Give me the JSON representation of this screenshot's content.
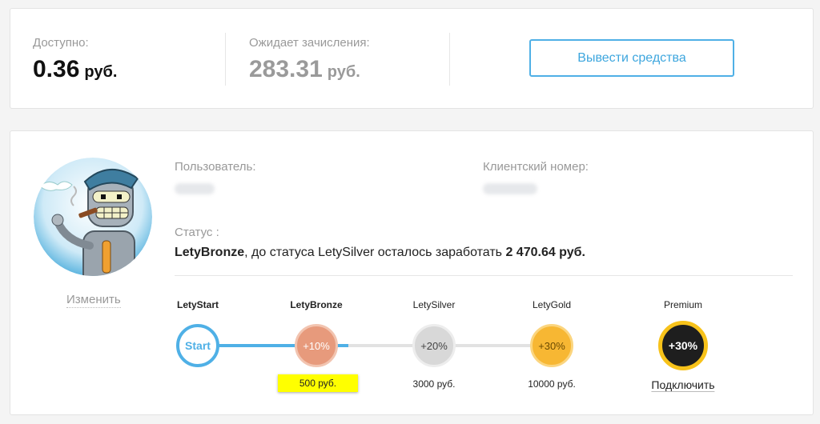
{
  "balance": {
    "available_label": "Доступно:",
    "available_value": "0.36",
    "currency": "руб.",
    "pending_label": "Ожидает зачисления:",
    "pending_value": "283.31",
    "withdraw_button": "Вывести средства"
  },
  "profile": {
    "change_link": "Изменить",
    "user_label": "Пользователь:",
    "client_number_label": "Клиентский номер:",
    "status_label": "Статус :",
    "status_current": "LetyBronze",
    "status_middle": ", до статуса LetySilver осталось заработать ",
    "status_amount": "2 470.64 руб."
  },
  "levels": [
    {
      "name": "LetyStart",
      "circle": "Start",
      "sub": ""
    },
    {
      "name": "LetyBronze",
      "circle": "+10%",
      "sub": "500 руб."
    },
    {
      "name": "LetySilver",
      "circle": "+20%",
      "sub": "3000 руб."
    },
    {
      "name": "LetyGold",
      "circle": "+30%",
      "sub": "10000 руб."
    },
    {
      "name": "Premium",
      "circle": "+30%",
      "sub": "Подключить"
    }
  ],
  "colors": {
    "accent_blue": "#4fb0e6",
    "bronze": "#e79a7c",
    "silver": "#d8d8d8",
    "gold": "#f7b733",
    "premium": "#1e1e1e",
    "highlight": "#ffff00"
  }
}
